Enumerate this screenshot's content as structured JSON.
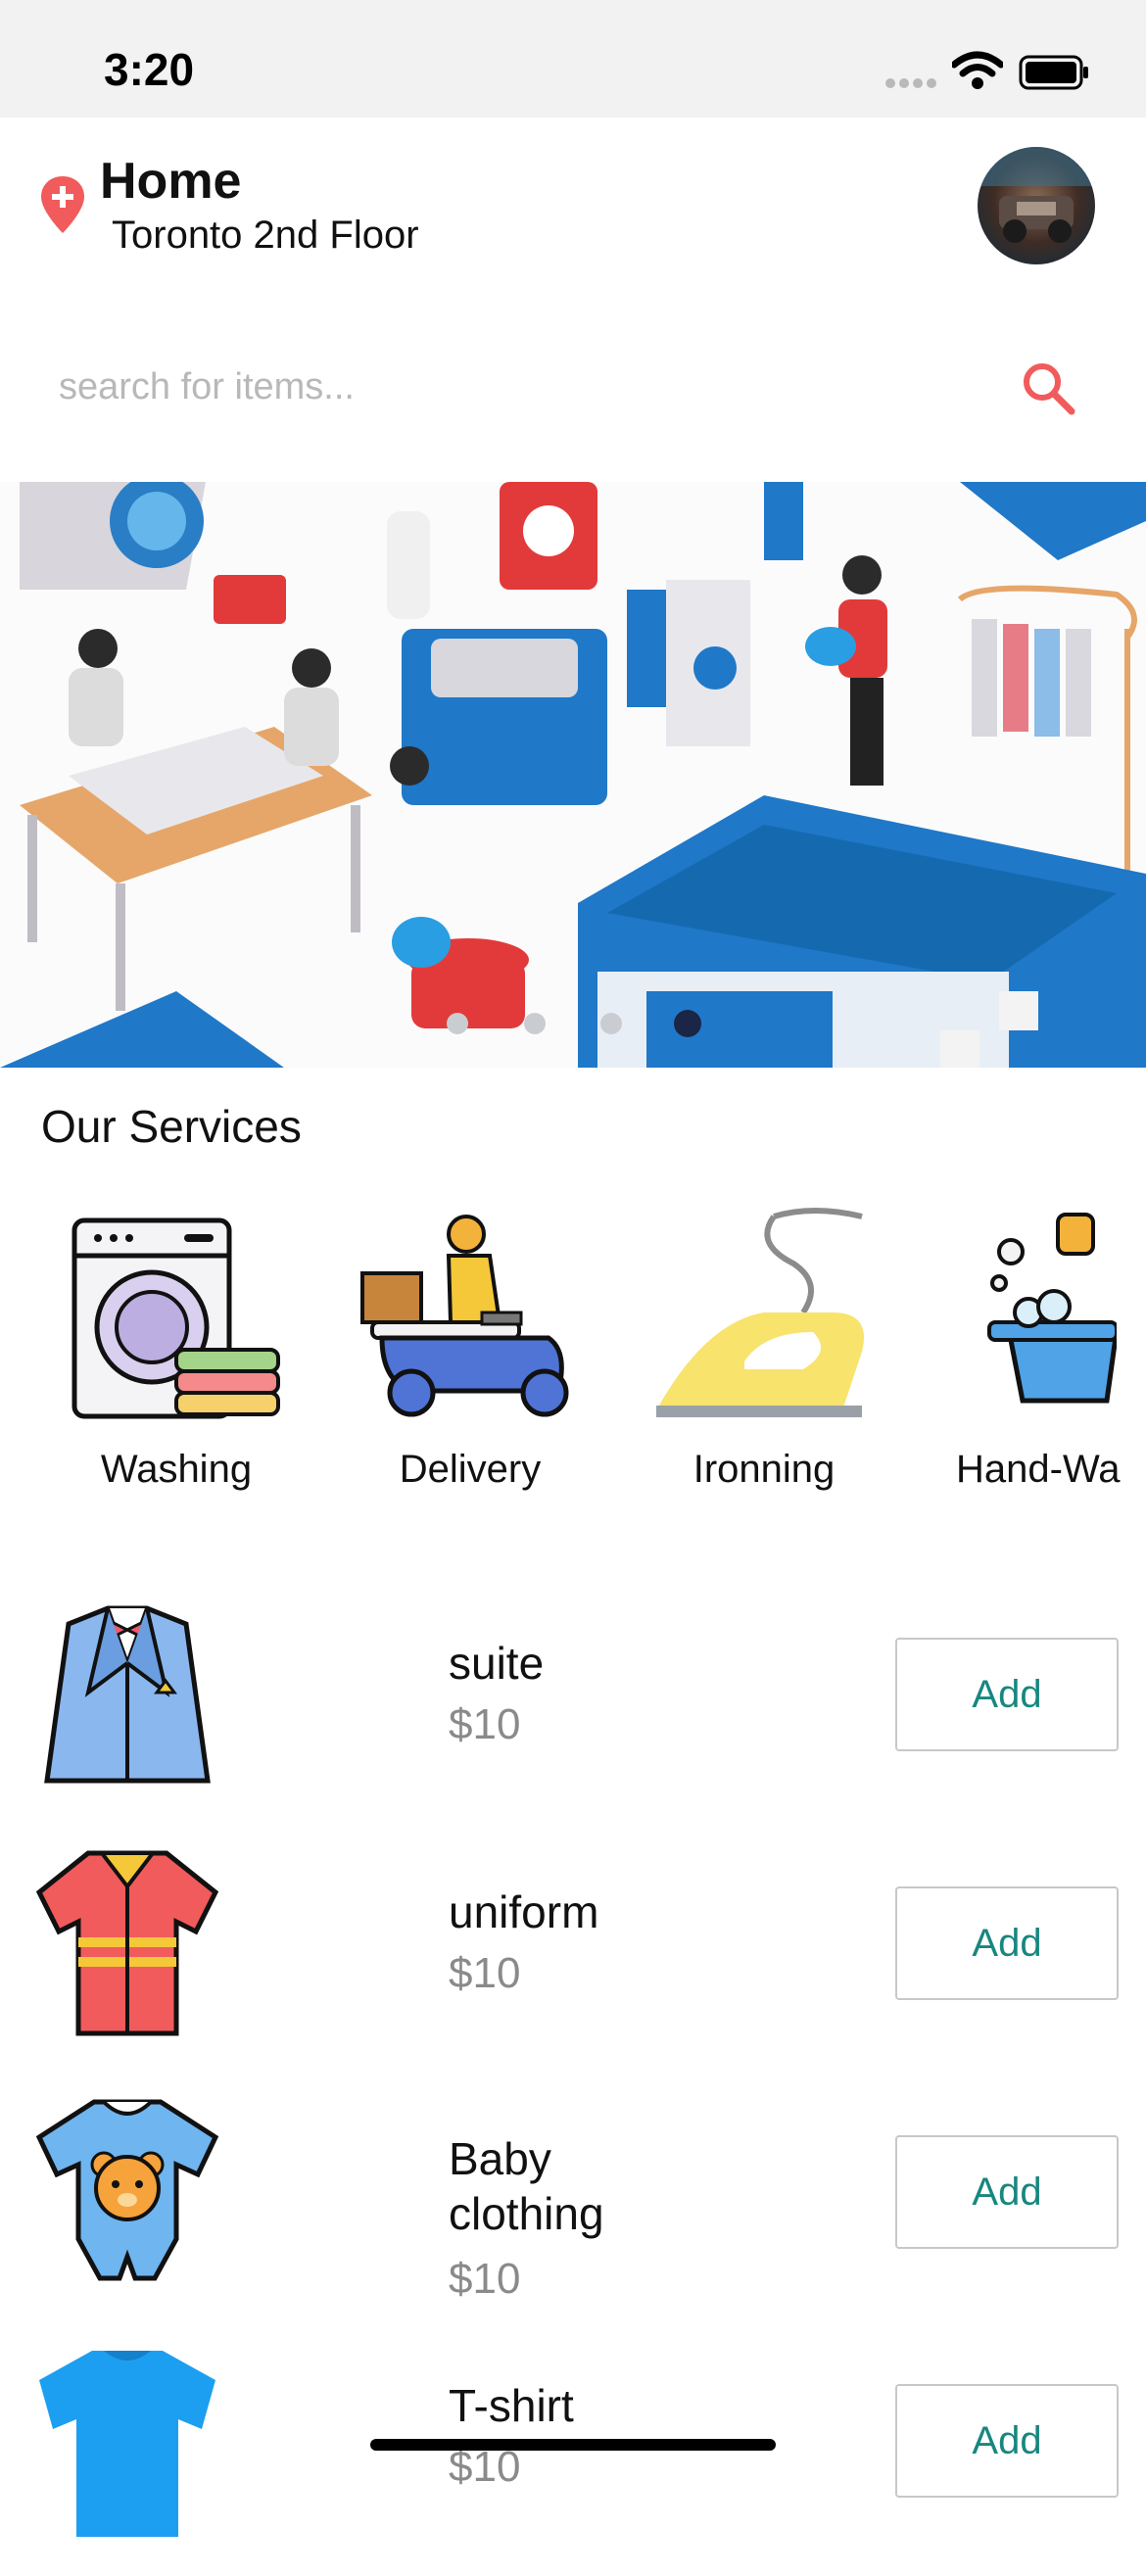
{
  "status_bar": {
    "time": "3:20"
  },
  "header": {
    "location_title": "Home",
    "location_subtitle": "Toronto 2nd Floor"
  },
  "search": {
    "placeholder": "search for items..."
  },
  "banner": {
    "slide_count": 4,
    "active_slide": 4
  },
  "services": {
    "title": "Our Services",
    "items": [
      {
        "label": "Washing",
        "icon": "washing-machine-icon"
      },
      {
        "label": "Delivery",
        "icon": "delivery-scooter-icon"
      },
      {
        "label": "Ironning",
        "icon": "iron-icon"
      },
      {
        "label": "Hand-Wa",
        "icon": "hand-wash-icon"
      }
    ]
  },
  "items": [
    {
      "name": "suite",
      "price": "$10",
      "add_label": "Add",
      "icon": "suit-icon"
    },
    {
      "name": "uniform",
      "price": "$10",
      "add_label": "Add",
      "icon": "uniform-icon"
    },
    {
      "name_line1": "Baby",
      "name_line2": "clothing",
      "price": "$10",
      "add_label": "Add",
      "icon": "baby-onesie-icon"
    },
    {
      "name": "T-shirt",
      "price": "$10",
      "add_label": "Add",
      "icon": "tshirt-icon"
    }
  ],
  "colors": {
    "accent_red": "#f15b5b",
    "add_text": "#17877f",
    "banner_blue": "#1f78c8"
  }
}
